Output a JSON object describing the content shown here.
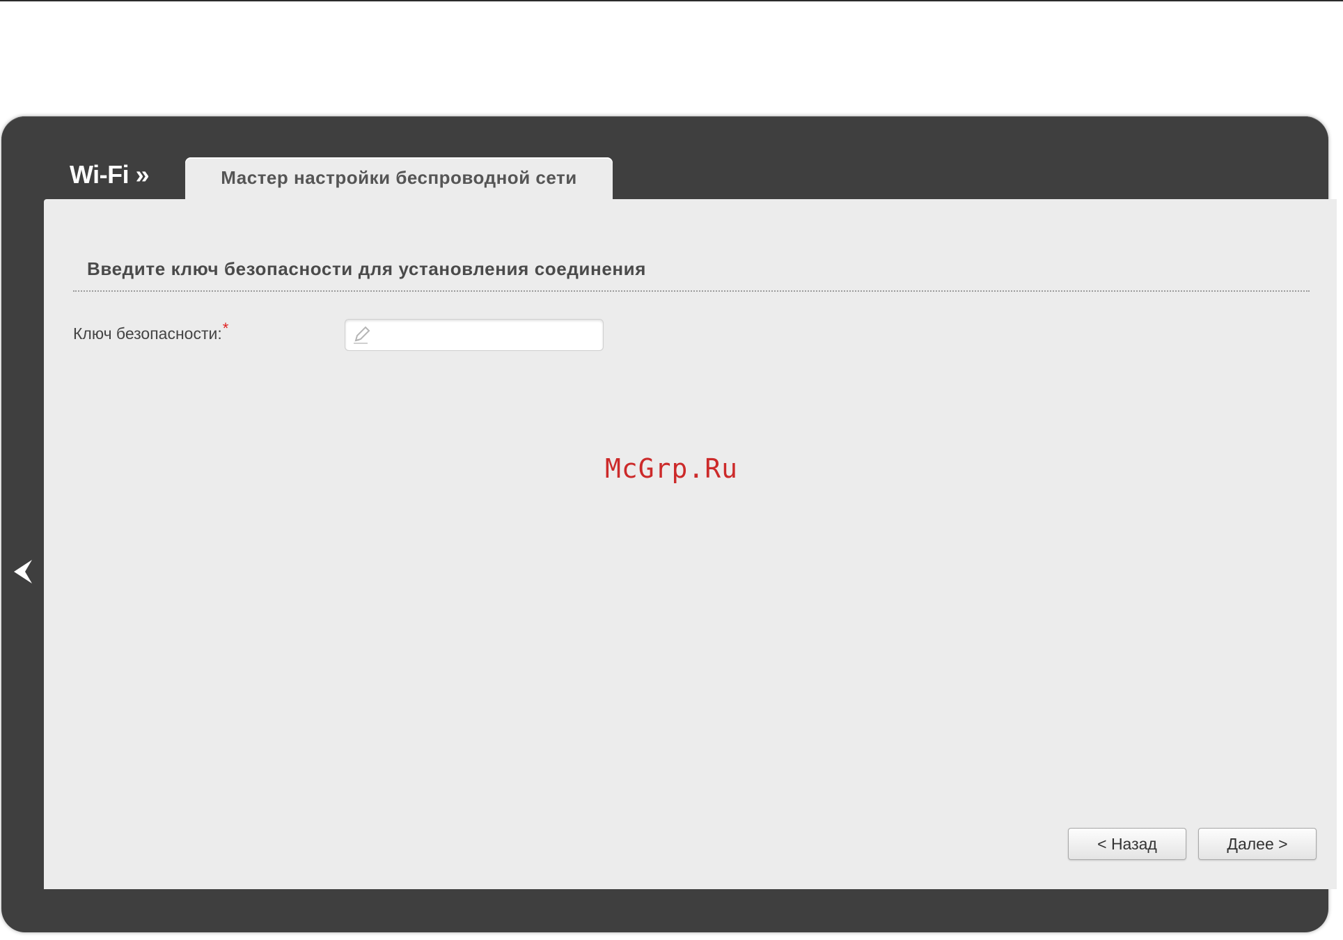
{
  "header": {
    "section_title": "Wi-Fi »",
    "tab_label": "Мастер настройки беспроводной сети"
  },
  "form": {
    "heading": "Введите ключ безопасности для установления соединения",
    "security_key": {
      "label": "Ключ безопасности:",
      "required_mark": "*",
      "value": ""
    }
  },
  "buttons": {
    "back": "< Назад",
    "next": "Далее >"
  },
  "watermark": "McGrp.Ru",
  "icons": {
    "input_icon": "pencil-icon",
    "side_nav": "chevron-left-icon"
  },
  "colors": {
    "frame": "#3f3f3f",
    "panel": "#ececec",
    "required": "#e02020",
    "watermark": "#cc2a2a"
  }
}
